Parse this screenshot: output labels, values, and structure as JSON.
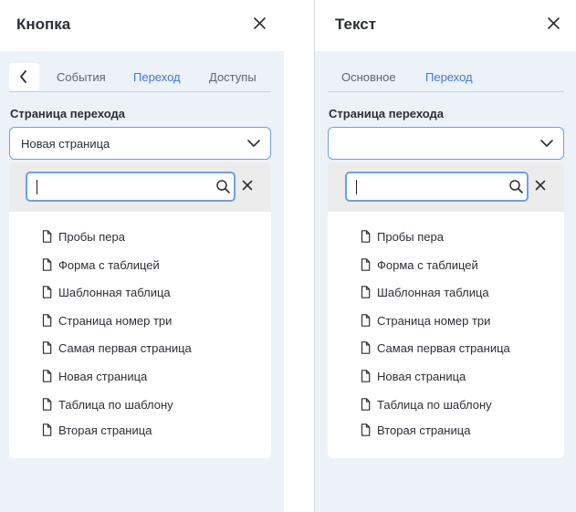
{
  "left_panel": {
    "title": "Кнопка",
    "tabs": [
      "События",
      "Переход",
      "Доступы"
    ],
    "active_tab": "Переход",
    "field_label": "Страница перехода",
    "selected_value": "Новая страница",
    "search_value": "",
    "pages": [
      "Пробы пера",
      "Форма с таблицей",
      "Шаблонная таблица",
      "Страница номер три",
      "Самая первая страница",
      "Новая страница",
      "Таблица по шаблону",
      "Вторая страница"
    ]
  },
  "right_panel": {
    "title": "Текст",
    "tabs": [
      "Основное",
      "Переход"
    ],
    "active_tab": "Переход",
    "field_label": "Страница перехода",
    "selected_value": "",
    "search_value": "",
    "pages": [
      "Пробы пера",
      "Форма с таблицей",
      "Шаблонная таблица",
      "Страница номер три",
      "Самая первая страница",
      "Новая страница",
      "Таблица по шаблону",
      "Вторая страница"
    ]
  },
  "icons": {
    "close": "close-icon",
    "back": "chevron-left-icon",
    "dropdown": "chevron-down-icon",
    "search": "search-icon",
    "clear": "clear-icon",
    "page": "document-icon"
  },
  "colors": {
    "accent": "#3b7bd9",
    "focus_border": "#6ea0e3",
    "panel_bg": "#edf1f8",
    "search_bar_bg": "#ececec"
  }
}
